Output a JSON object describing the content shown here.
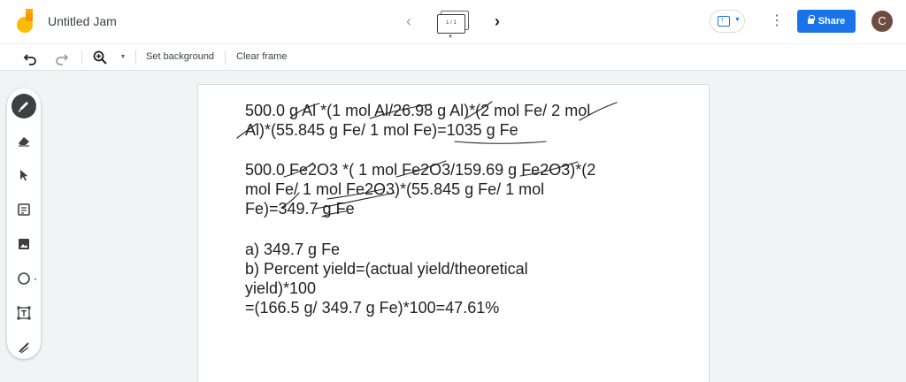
{
  "app": {
    "title": "Untitled Jam",
    "frame_indicator": "1 / 1",
    "share_label": "Share",
    "avatar_letter": "C",
    "accent_color": "#1a73e8",
    "logo_colors": [
      "#fbbc04",
      "#f9ab00"
    ]
  },
  "toolbar": {
    "undo_icon": "undo-icon",
    "redo_icon": "redo-icon",
    "zoom_icon": "zoom-in-icon",
    "set_background_label": "Set background",
    "clear_frame_label": "Clear frame"
  },
  "tools": [
    {
      "name": "pen",
      "icon": "pen-icon",
      "active": true
    },
    {
      "name": "eraser",
      "icon": "eraser-icon"
    },
    {
      "name": "select",
      "icon": "cursor-icon"
    },
    {
      "name": "sticky-note",
      "icon": "sticky-note-icon"
    },
    {
      "name": "image",
      "icon": "image-icon"
    },
    {
      "name": "circle",
      "icon": "circle-icon"
    },
    {
      "name": "text-box",
      "icon": "text-box-icon"
    },
    {
      "name": "laser",
      "icon": "laser-icon"
    }
  ],
  "content": {
    "block1": [
      "500.0 g Al *(1 mol Al/26.98 g Al)*(2 mol Fe/ 2 mol",
      "Al)*(55.845 g Fe/ 1 mol Fe)=1035 g Fe"
    ],
    "block2": [
      "500.0 Fe2O3 *( 1 mol Fe2O3/159.69 g Fe2O3)*(2",
      "mol Fe/ 1 mol Fe2O3)*(55.845 g Fe/ 1 mol",
      "Fe)=349.7 g Fe"
    ],
    "block3": [
      "a) 349.7 g Fe",
      "b) Percent yield=(actual yield/theoretical",
      "yield)*100",
      "=(166.5 g/ 349.7 g Fe)*100=47.61%"
    ]
  }
}
